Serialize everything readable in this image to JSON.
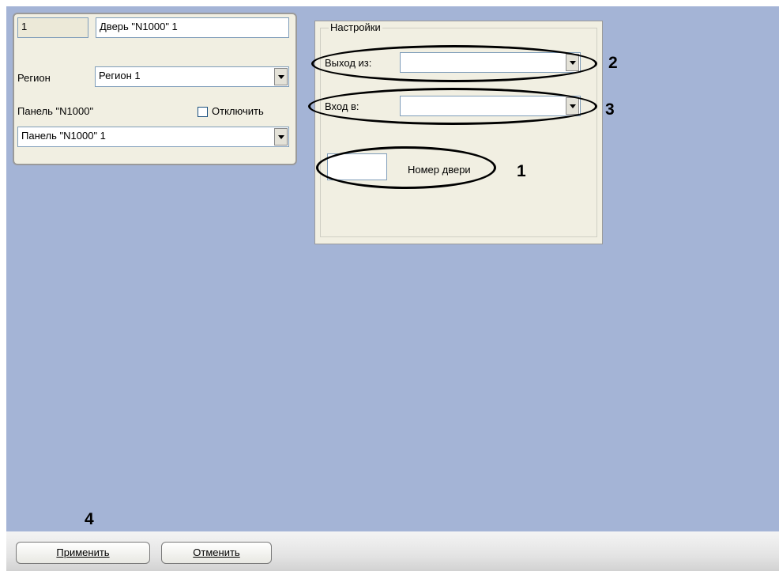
{
  "object_panel": {
    "id_value": "1",
    "name_value": "Дверь \"N1000\" 1",
    "region_label": "Регион",
    "region_value": "Регион 1",
    "panel_label": "Панель \"N1000\"",
    "disable_label": "Отключить",
    "panel_value": "Панель \"N1000\" 1"
  },
  "settings": {
    "legend": "Настройки",
    "exit_label": "Выход из:",
    "exit_value": "",
    "entry_label": "Вход в:",
    "entry_value": "",
    "door_number_label": "Номер двери",
    "door_number_value": ""
  },
  "annotations": {
    "n1": "1",
    "n2": "2",
    "n3": "3",
    "n4": "4"
  },
  "buttons": {
    "apply": "Применить",
    "cancel": "Отменить"
  },
  "colors": {
    "workspace": "#a4b4d6",
    "panel": "#f1efe2",
    "annotation": "#000000"
  }
}
